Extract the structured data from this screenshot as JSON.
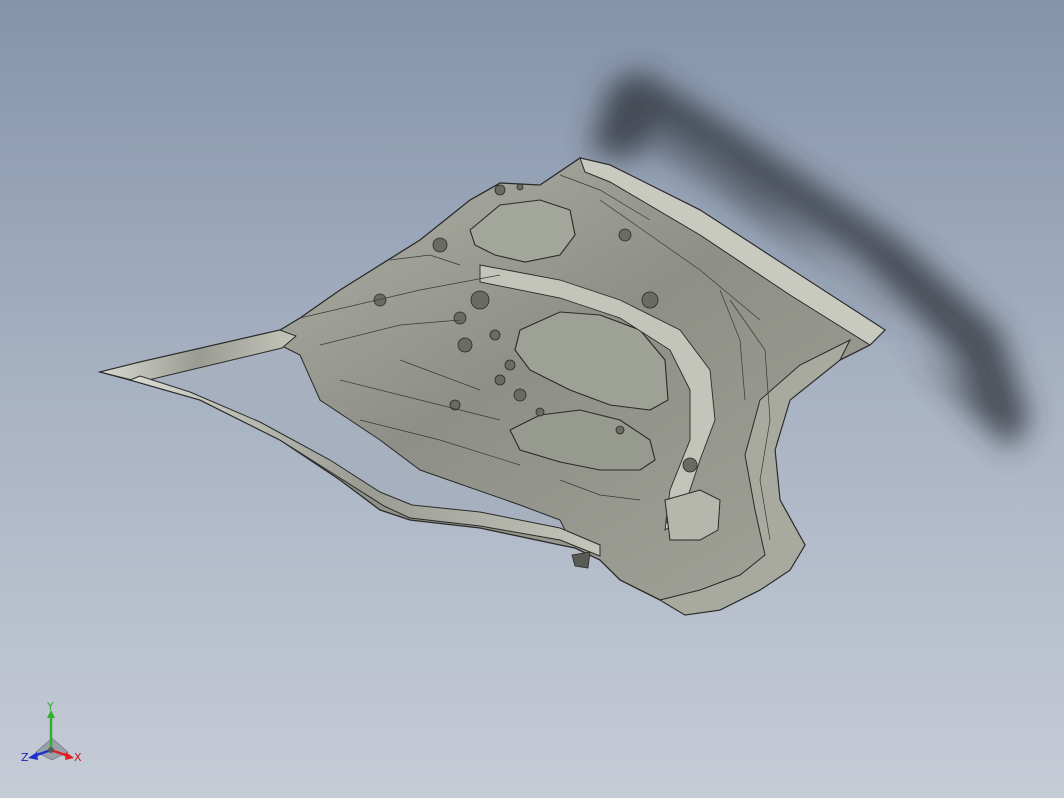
{
  "viewport": {
    "colors": {
      "background_top": "#8594ab",
      "background_bottom": "#c6ccd6",
      "part_fill": "#8d8e85",
      "part_fill_light": "#c9cac0",
      "part_edge": "#2a2a2a",
      "shadow": "#2c2f36"
    }
  },
  "model": {
    "name_icon": "car-door-inner-panel-icon"
  },
  "triad": {
    "x_label": "X",
    "y_label": "Y",
    "z_label": "Z",
    "x_color": "#e02020",
    "y_color": "#2fb02f",
    "z_color": "#2030d0"
  }
}
